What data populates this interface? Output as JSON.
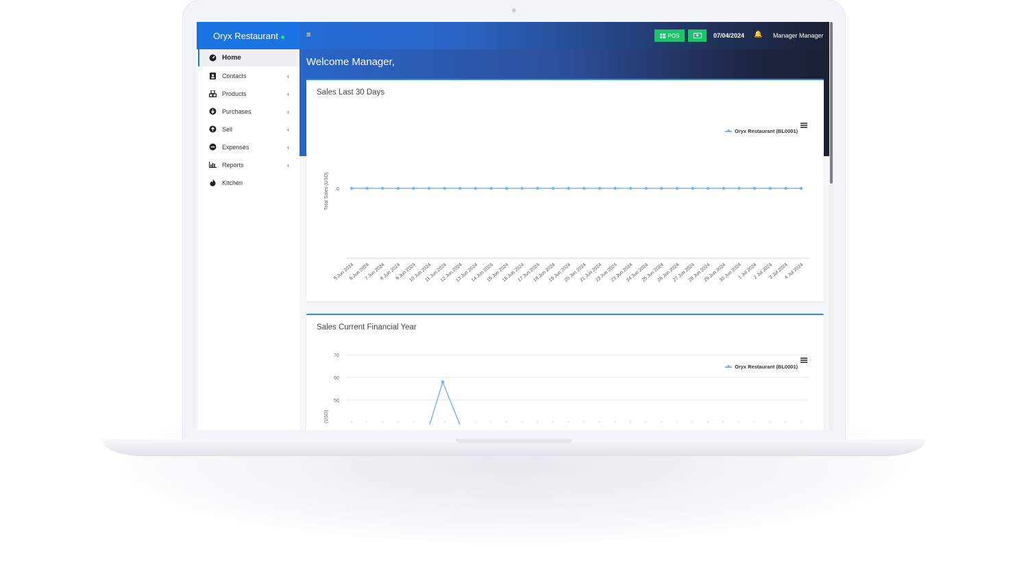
{
  "brand": {
    "name": "Oryx Restaurant"
  },
  "topbar": {
    "pos_label": "POS",
    "date": "07/04/2024",
    "user_name": "Manager Manager"
  },
  "sidebar": {
    "items": [
      {
        "label": "Home",
        "icon": "dashboard-icon",
        "active": true,
        "has_chevron": false
      },
      {
        "label": "Contacts",
        "icon": "address-book-icon",
        "active": false,
        "has_chevron": true
      },
      {
        "label": "Products",
        "icon": "cubes-icon",
        "active": false,
        "has_chevron": true
      },
      {
        "label": "Purchases",
        "icon": "arrow-circle-down-icon",
        "active": false,
        "has_chevron": true
      },
      {
        "label": "Sell",
        "icon": "arrow-circle-up-icon",
        "active": false,
        "has_chevron": true
      },
      {
        "label": "Expenses",
        "icon": "minus-circle-icon",
        "active": false,
        "has_chevron": true
      },
      {
        "label": "Reports",
        "icon": "bar-chart-icon",
        "active": false,
        "has_chevron": true
      },
      {
        "label": "Kitchen",
        "icon": "fire-icon",
        "active": false,
        "has_chevron": false
      }
    ]
  },
  "main": {
    "welcome": "Welcome Manager,"
  },
  "colors": {
    "accent": "#1b74e4",
    "pos_green": "#1fc46a",
    "series": "#7cb5ec"
  },
  "chart_data": [
    {
      "type": "line",
      "title": "Sales Last 30 Days",
      "ylabel": "Total Sales (USD)",
      "y_ticks": [
        "0"
      ],
      "legend": "Oryx Restaurant (BL0001)",
      "legend_position": "top-right",
      "categories": [
        "5 Jun 2024",
        "6 Jun 2024",
        "7 Jun 2024",
        "8 Jun 2024",
        "9 Jun 2024",
        "10 Jun 2024",
        "11 Jun 2024",
        "12 Jun 2024",
        "13 Jun 2024",
        "14 Jun 2024",
        "15 Jun 2024",
        "16 Jun 2024",
        "17 Jun 2024",
        "18 Jun 2024",
        "19 Jun 2024",
        "20 Jun 2024",
        "21 Jun 2024",
        "22 Jun 2024",
        "23 Jun 2024",
        "24 Jun 2024",
        "25 Jun 2024",
        "26 Jun 2024",
        "27 Jun 2024",
        "28 Jun 2024",
        "29 Jun 2024",
        "30 Jun 2024",
        "1 Jul 2024",
        "2 Jul 2024",
        "3 Jul 2024",
        "4 Jul 2024"
      ],
      "series": [
        {
          "name": "Oryx Restaurant (BL0001)",
          "values": [
            0,
            0,
            0,
            0,
            0,
            0,
            0,
            0,
            0,
            0,
            0,
            0,
            0,
            0,
            0,
            0,
            0,
            0,
            0,
            0,
            0,
            0,
            0,
            0,
            0,
            0,
            0,
            0,
            0,
            0
          ]
        }
      ]
    },
    {
      "type": "line",
      "title": "Sales Current Financial Year",
      "ylabel": "(USD)",
      "y_ticks": [
        "70",
        "60",
        "50"
      ],
      "ylim": [
        40,
        70
      ],
      "legend": "Oryx Restaurant (BL0001)",
      "legend_position": "top-right",
      "series": [
        {
          "name": "Oryx Restaurant (BL0001)",
          "peak_index": 6,
          "peak_value": 58
        }
      ]
    }
  ]
}
